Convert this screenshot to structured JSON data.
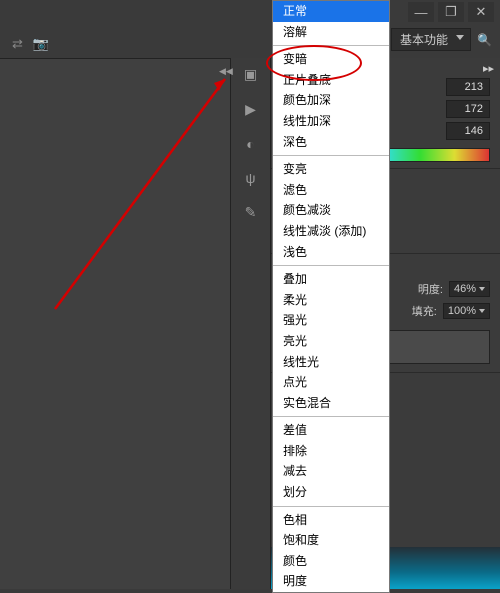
{
  "window": {
    "minimize": "—",
    "restore": "❐",
    "close": "✕"
  },
  "top": {
    "mode_label": "基本功能"
  },
  "panel": {
    "r": "213",
    "g": "172",
    "b": "146",
    "opacity_label": "明度:",
    "opacity_value": "46%",
    "fill_label": "填充:",
    "fill_value": "100%"
  },
  "menu": {
    "selected": "正常",
    "g1": [
      "溶解"
    ],
    "g2": [
      "变暗",
      "正片叠底",
      "颜色加深",
      "线性加深",
      "深色"
    ],
    "g3": [
      "变亮",
      "滤色",
      "颜色减淡",
      "线性减淡 (添加)",
      "浅色"
    ],
    "g4": [
      "叠加",
      "柔光",
      "强光",
      "亮光",
      "线性光",
      "点光",
      "实色混合"
    ],
    "g5": [
      "差值",
      "排除",
      "减去",
      "划分"
    ],
    "g6": [
      "色相",
      "饱和度",
      "颜色",
      "明度"
    ]
  }
}
